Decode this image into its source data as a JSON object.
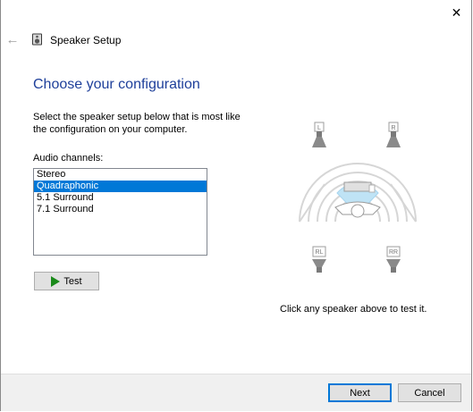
{
  "window": {
    "title": "Speaker Setup",
    "close_glyph": "✕",
    "back_glyph": "←"
  },
  "page": {
    "heading": "Choose your configuration",
    "instructions": "Select the speaker setup below that is most like the configuration on your computer.",
    "channels_label": "Audio channels:",
    "hint": "Click any speaker above to test it."
  },
  "channels": {
    "selected": "Quadraphonic",
    "items": [
      "Stereo",
      "Quadraphonic",
      "5.1 Surround",
      "7.1 Surround"
    ]
  },
  "speakers": {
    "front_left": "L",
    "front_right": "R",
    "rear_left": "RL",
    "rear_right": "RR"
  },
  "buttons": {
    "test": "Test",
    "next": "Next",
    "cancel": "Cancel"
  },
  "colors": {
    "heading": "#1e3f9a",
    "selection": "#0078d7",
    "play": "#1a8a1a",
    "sound_wave": "#bfe3f5"
  },
  "icons": {
    "back": "back-arrow-icon",
    "close": "close-icon",
    "app": "speaker-icon",
    "test": "play-icon"
  }
}
